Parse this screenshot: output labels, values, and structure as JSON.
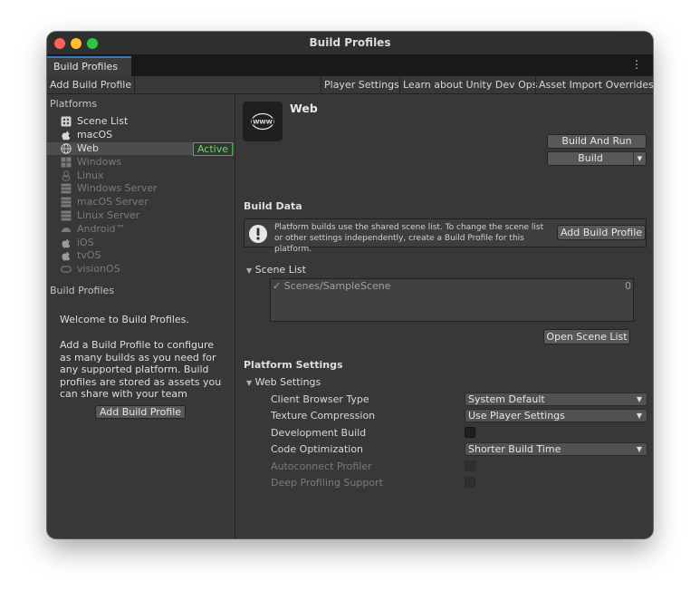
{
  "window": {
    "title": "Build Profiles"
  },
  "tab": {
    "label": "Build Profiles",
    "menu_glyph": "⋮"
  },
  "toolbar": {
    "add_build_profile": "Add Build Profile",
    "player_settings": "Player Settings",
    "learn_dev_ops": "Learn about Unity Dev Ops",
    "asset_import_overrides": "Asset Import Overrides"
  },
  "sidebar": {
    "platforms_heading": "Platforms",
    "platforms": [
      {
        "label": "Scene List",
        "icon": "scene-list-icon"
      },
      {
        "label": "macOS",
        "icon": "apple-icon"
      },
      {
        "label": "Web",
        "icon": "web-icon",
        "badge": "Active"
      },
      {
        "label": "Windows",
        "icon": "windows-icon"
      },
      {
        "label": "Linux",
        "icon": "linux-icon"
      },
      {
        "label": "Windows Server",
        "icon": "server-icon"
      },
      {
        "label": "macOS Server",
        "icon": "server-icon"
      },
      {
        "label": "Linux Server",
        "icon": "server-icon"
      },
      {
        "label": "Android™",
        "icon": "android-icon"
      },
      {
        "label": "iOS",
        "icon": "apple-icon"
      },
      {
        "label": "tvOS",
        "icon": "apple-icon"
      },
      {
        "label": "visionOS",
        "icon": "visionos-icon"
      }
    ],
    "build_profiles_heading": "Build Profiles",
    "welcome_title": "Welcome to Build Profiles.",
    "welcome_body": "Add a Build Profile to configure as many builds as you need for any supported platform. Build profiles are stored as assets you can share with your team",
    "add_button": "Add Build Profile"
  },
  "main": {
    "platform_name": "Web",
    "build_and_run": "Build And Run",
    "build": "Build",
    "build_data_heading": "Build Data",
    "info_text": "Platform builds use the shared scene list. To change the scene list or other settings independently, create a Build Profile for this platform.",
    "info_button": "Add Build Profile",
    "scene_list_heading": "Scene List",
    "scenes": [
      {
        "name": "Scenes/SampleScene",
        "index": "0"
      }
    ],
    "open_scene_list": "Open Scene List",
    "platform_settings_heading": "Platform Settings",
    "web_settings_heading": "Web Settings",
    "settings": {
      "client_browser_type": {
        "label": "Client Browser Type",
        "value": "System Default"
      },
      "texture_compression": {
        "label": "Texture Compression",
        "value": "Use Player Settings"
      },
      "development_build": {
        "label": "Development Build"
      },
      "code_optimization": {
        "label": "Code Optimization",
        "value": "Shorter Build Time"
      },
      "autoconnect_profiler": {
        "label": "Autoconnect Profiler"
      },
      "deep_profiling_support": {
        "label": "Deep Profiling Support"
      }
    }
  },
  "colors": {
    "accent": "#3a79bb",
    "active_badge": "#77d177",
    "panel": "#383838"
  }
}
